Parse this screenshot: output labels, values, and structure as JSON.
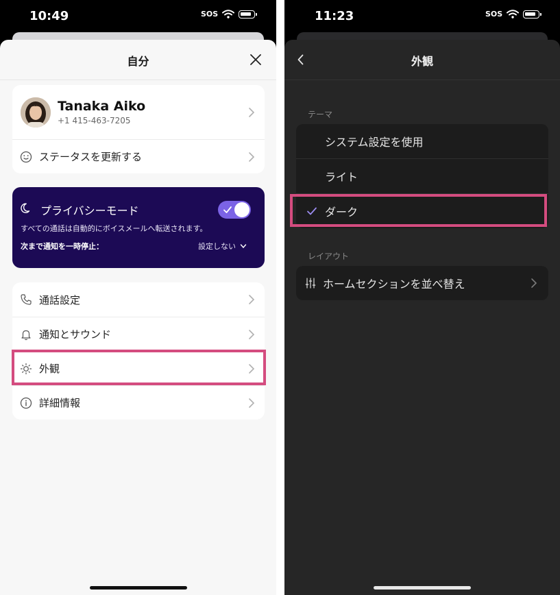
{
  "left": {
    "status": {
      "time": "10:49",
      "sos": "SOS"
    },
    "title": "自分",
    "profile": {
      "name": "Tanaka Aiko",
      "phone": "+1 415-463-7205"
    },
    "status_update": "ステータスを更新する",
    "privacy_mode": {
      "title": "プライバシーモード",
      "enabled": true,
      "description": "すべての通話は自動的にボイスメールへ転送されます。",
      "pause_label": "次まで通知を一時停止：",
      "pause_value": "設定しない"
    },
    "menu": [
      {
        "label": "通話設定",
        "icon": "phone-icon"
      },
      {
        "label": "通知とサウンド",
        "icon": "bell-icon"
      },
      {
        "label": "外観",
        "icon": "sun-icon",
        "highlighted": true
      },
      {
        "label": "詳細情報",
        "icon": "info-icon"
      }
    ]
  },
  "right": {
    "status": {
      "time": "11:23",
      "sos": "SOS"
    },
    "title": "外観",
    "theme_label": "テーマ",
    "theme_options": [
      {
        "label": "システム設定を使用",
        "selected": false
      },
      {
        "label": "ライト",
        "selected": false
      },
      {
        "label": "ダーク",
        "selected": true
      }
    ],
    "layout_label": "レイアウト",
    "layout_item": {
      "label": "ホームセクションを並べ替え",
      "icon": "sliders-icon"
    }
  },
  "colors": {
    "highlight": "#d44c7f",
    "privacy_bg": "#1c0a55",
    "toggle": "#7b63e6",
    "check": "#9b8cf0"
  }
}
